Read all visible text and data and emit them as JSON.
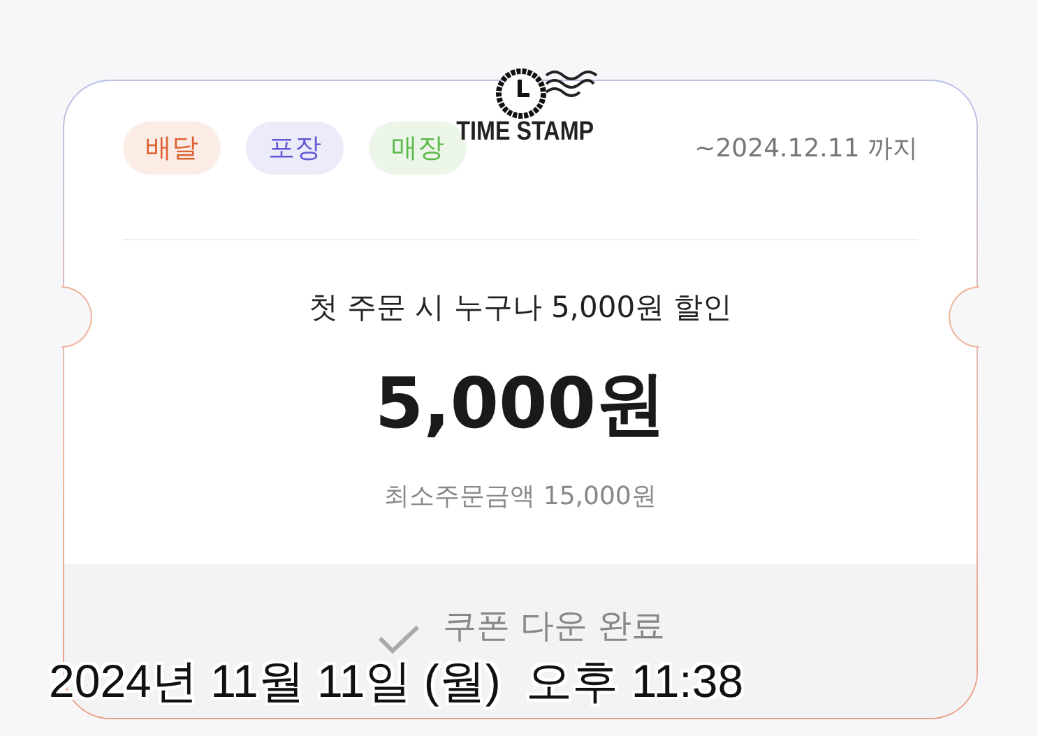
{
  "coupon": {
    "tags": [
      {
        "label": "배달",
        "color": "#dd6233"
      },
      {
        "label": "포장",
        "color": "#6259d6"
      },
      {
        "label": "매장",
        "color": "#5cb84a"
      }
    ],
    "valid_until": "~2024.12.11 까지",
    "title": "첫 주문 시 누구나 5,000원 할인",
    "amount": "5,000원",
    "minimum_order": "최소주문금액 15,000원",
    "download_status": {
      "label": "쿠폰 다운 완료",
      "done": true
    }
  },
  "stamp_overlay": {
    "logo_text": "TIME STAMP",
    "datetime": "2024년 11월 11일 (월)  오후 11:38"
  }
}
